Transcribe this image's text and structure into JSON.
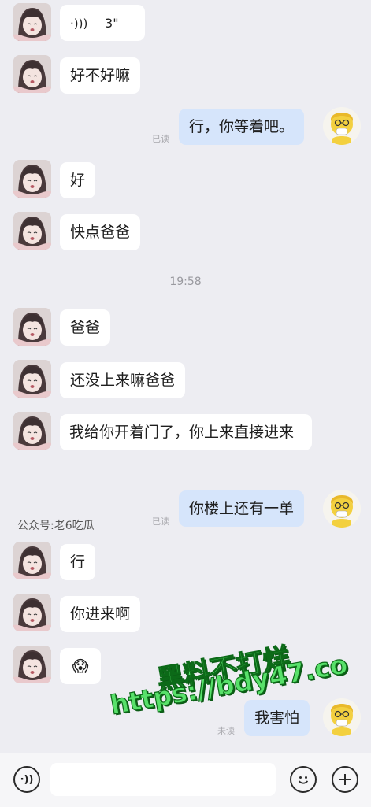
{
  "messages": [
    {
      "id": "m1",
      "sender": "other",
      "type": "voice",
      "text": "3\""
    },
    {
      "id": "m2",
      "sender": "other",
      "text": "好不好嘛"
    },
    {
      "id": "m3",
      "sender": "me",
      "text": "行，你等着吧。",
      "status": "已读"
    },
    {
      "id": "m4",
      "sender": "other",
      "text": "好"
    },
    {
      "id": "m5",
      "sender": "other",
      "text": "快点爸爸"
    },
    {
      "id": "m6",
      "sender": "other",
      "text": "爸爸"
    },
    {
      "id": "m7",
      "sender": "other",
      "text": "还没上来嘛爸爸"
    },
    {
      "id": "m8",
      "sender": "other",
      "text": "我给你开着门了，你上来直接进来"
    },
    {
      "id": "m9",
      "sender": "me",
      "text": "你楼上还有一单",
      "status": "已读"
    },
    {
      "id": "m10",
      "sender": "other",
      "text": "行"
    },
    {
      "id": "m11",
      "sender": "other",
      "text": "你进来啊"
    },
    {
      "id": "m12",
      "sender": "other",
      "type": "emoji",
      "text": "😱"
    },
    {
      "id": "m13",
      "sender": "me",
      "text": "我害怕",
      "status": "未读"
    }
  ],
  "timestamp": "19:58",
  "watermarks": {
    "account": "公众号:老6吃瓜",
    "line1": "黑料不打烊",
    "line2": "https://bdy47.co"
  },
  "bottom_bar": {
    "voice_icon": "voice-icon",
    "emoji_icon": "smiley-icon",
    "plus_icon": "plus-icon"
  },
  "colors": {
    "background": "#ededf2",
    "my_bubble": "#d6e5fb",
    "other_bubble": "#ffffff",
    "watermark_green": "#58e06a"
  }
}
